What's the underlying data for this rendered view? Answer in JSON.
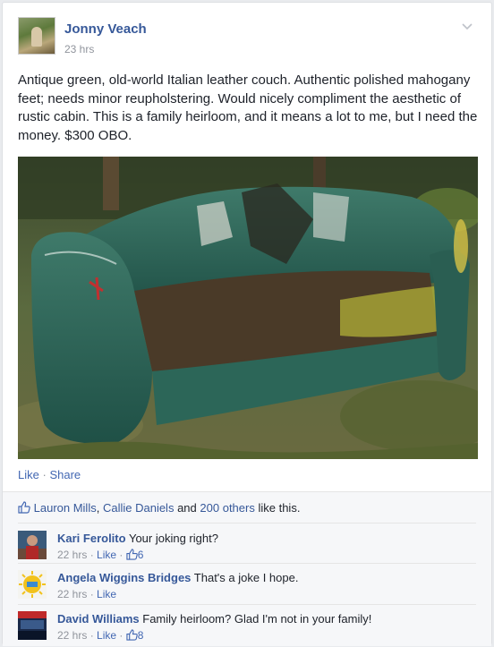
{
  "post": {
    "author": "Jonny Veach",
    "time": "23 hrs",
    "text": "Antique green, old-world Italian leather couch. Authentic polished mahogany feet; needs minor reupholstering. Would nicely compliment the aesthetic of rustic cabin. This is a family heirloom, and it means a lot to me, but I need the money. $300 OBO."
  },
  "actions": {
    "like": "Like",
    "separator": "·",
    "share": "Share"
  },
  "likes": {
    "person1": "Lauron Mills",
    "comma": ",",
    "person2": "Callie Daniels",
    "and": "and",
    "others": "200 others",
    "suffix": "like this."
  },
  "comments": [
    {
      "name": "Kari Ferolito",
      "text": "Your joking right?",
      "time": "22 hrs",
      "like": "Like",
      "separator": "·",
      "likes_count": "6"
    },
    {
      "name": "Angela Wiggins Bridges",
      "text": "That's a joke I hope.",
      "time": "22 hrs",
      "like": "Like",
      "separator": "·",
      "likes_count": ""
    },
    {
      "name": "David Williams",
      "text": "Family heirloom? Glad I'm not in your family!",
      "time": "22 hrs",
      "like": "Like",
      "separator": "·",
      "likes_count": "8"
    }
  ],
  "colors": {
    "link": "#365899",
    "action": "#4267b2",
    "muted": "#90949c"
  }
}
